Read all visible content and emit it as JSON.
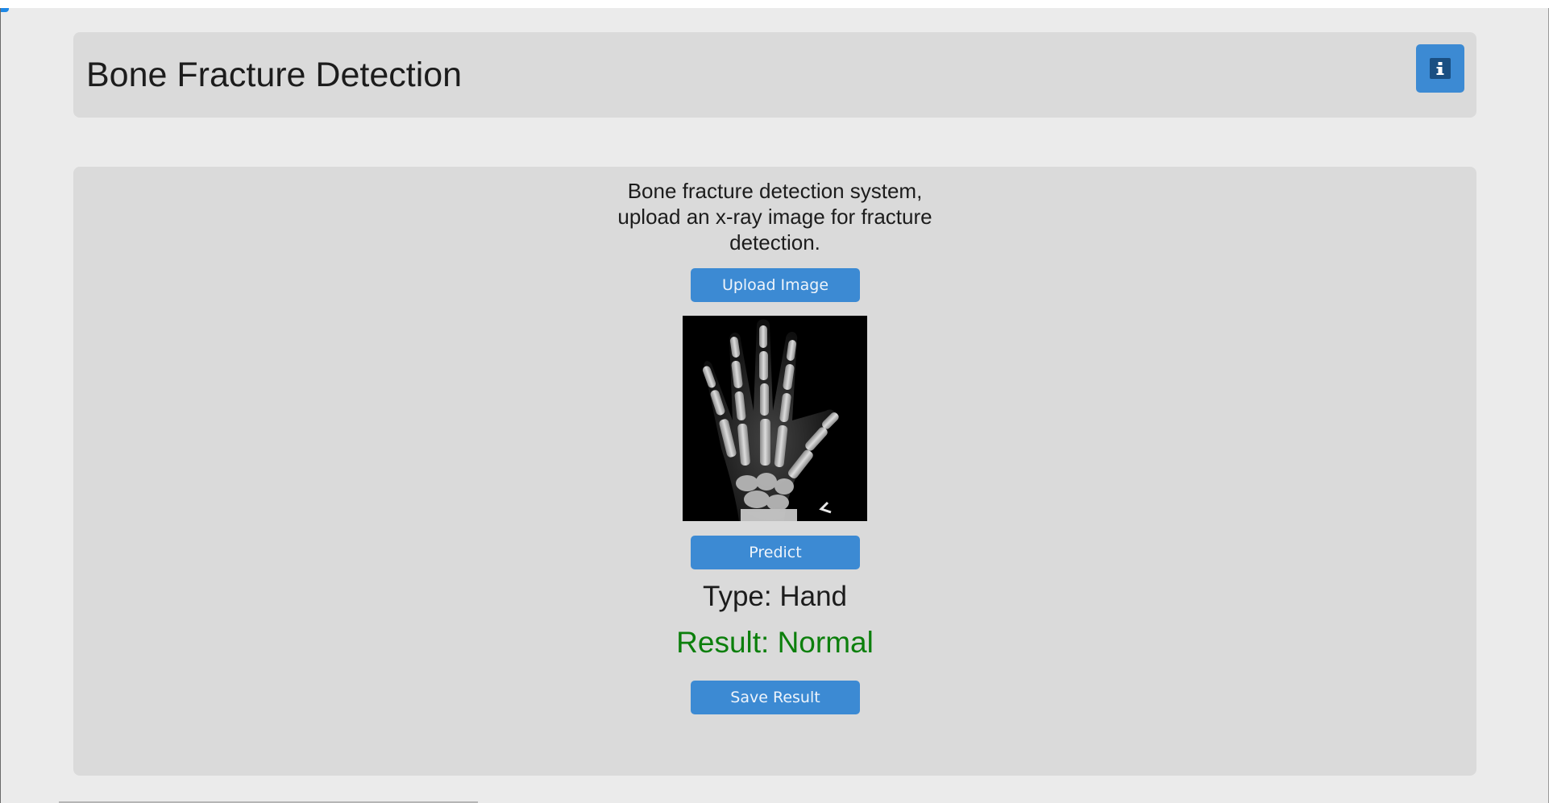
{
  "header": {
    "title": "Bone Fracture Detection",
    "info_icon": "info-icon"
  },
  "main": {
    "description": "Bone fracture detection system, upload an x-ray image for fracture detection.",
    "upload_label": "Upload Image",
    "predict_label": "Predict",
    "type_text": "Type: Hand",
    "result_text": "Result: Normal",
    "save_label": "Save Result"
  },
  "colors": {
    "accent": "#3c8ad3",
    "panel": "#dadada",
    "background": "#ebebeb",
    "result_normal": "#0c7f0c"
  }
}
